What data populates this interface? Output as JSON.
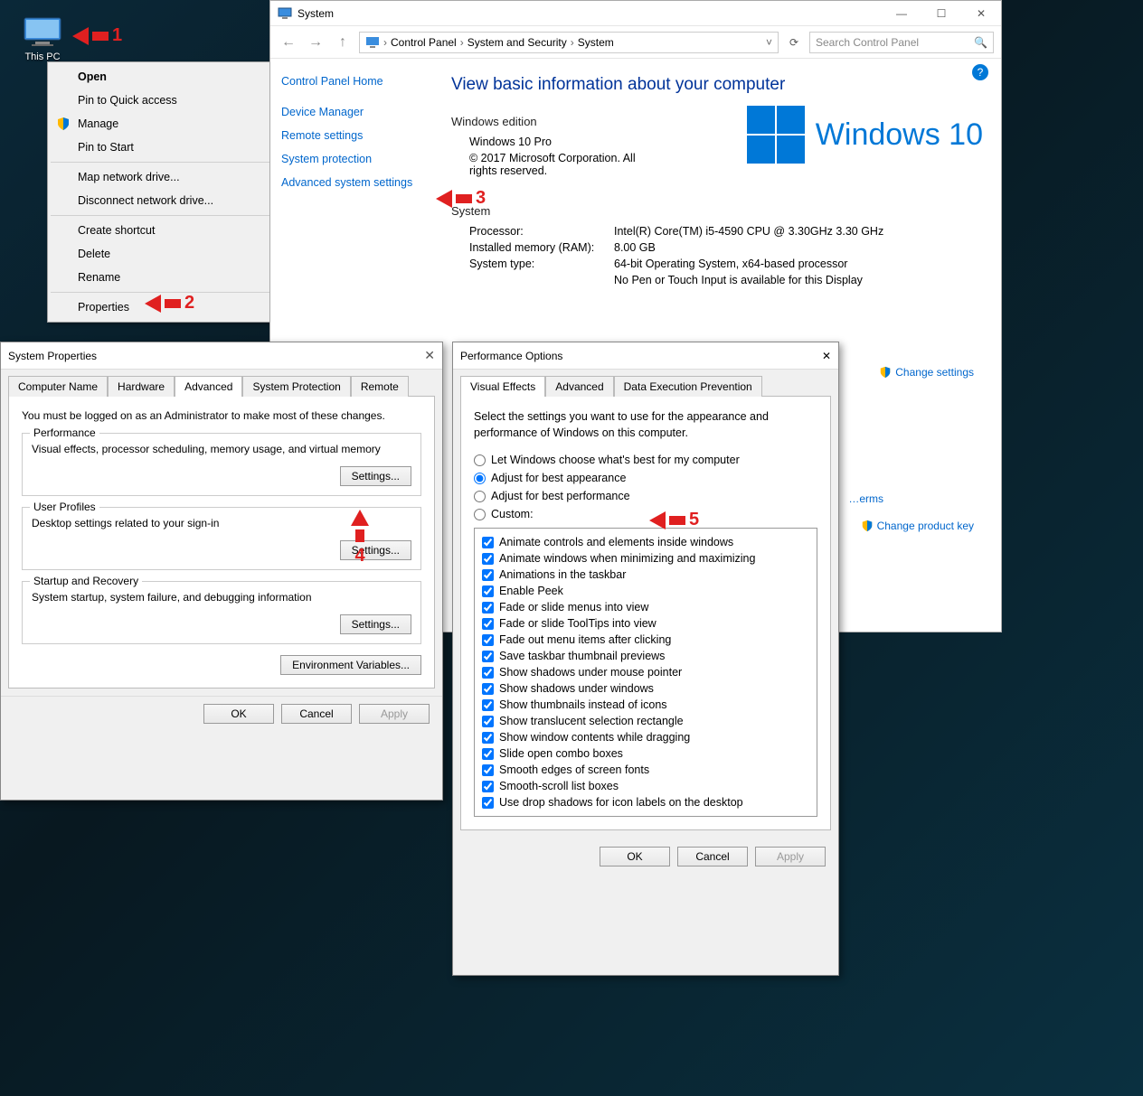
{
  "desktop": {
    "icon_label": "This PC"
  },
  "context_menu": {
    "items": [
      {
        "label": "Open",
        "bold": true
      },
      {
        "label": "Pin to Quick access"
      },
      {
        "label": "Manage",
        "shield": true
      },
      {
        "label": "Pin to Start"
      },
      {
        "sep": true
      },
      {
        "label": "Map network drive..."
      },
      {
        "label": "Disconnect network drive..."
      },
      {
        "sep": true
      },
      {
        "label": "Create shortcut"
      },
      {
        "label": "Delete"
      },
      {
        "label": "Rename"
      },
      {
        "sep": true
      },
      {
        "label": "Properties"
      }
    ]
  },
  "syswin": {
    "title": "System",
    "breadcrumb": [
      "Control Panel",
      "System and Security",
      "System"
    ],
    "search_placeholder": "Search Control Panel",
    "sidebar": {
      "home": "Control Panel Home",
      "links": [
        "Device Manager",
        "Remote settings",
        "System protection",
        "Advanced system settings"
      ]
    },
    "heading": "View basic information about your computer",
    "edition_hdr": "Windows edition",
    "edition": "Windows 10 Pro",
    "copyright": "© 2017 Microsoft Corporation. All rights reserved.",
    "logo_text": "Windows 10",
    "system_hdr": "System",
    "rows": [
      {
        "k": "Processor:",
        "v": "Intel(R) Core(TM) i5-4590 CPU @ 3.30GHz   3.30 GHz"
      },
      {
        "k": "Installed memory (RAM):",
        "v": "8.00 GB"
      },
      {
        "k": "System type:",
        "v": "64-bit Operating System, x64-based processor"
      }
    ],
    "pen_touch_v": "No Pen or Touch Input is available for this Display",
    "change_settings": "Change settings",
    "change_product_key": "Change product key",
    "see_also_terms": "Read the Microsoft Software License Terms"
  },
  "sysprops": {
    "title": "System Properties",
    "tabs": [
      "Computer Name",
      "Hardware",
      "Advanced",
      "System Protection",
      "Remote"
    ],
    "active_tab": 2,
    "admin_note": "You must be logged on as an Administrator to make most of these changes.",
    "groups": [
      {
        "title": "Performance",
        "desc": "Visual effects, processor scheduling, memory usage, and virtual memory",
        "btn": "Settings..."
      },
      {
        "title": "User Profiles",
        "desc": "Desktop settings related to your sign-in",
        "btn": "Settings..."
      },
      {
        "title": "Startup and Recovery",
        "desc": "System startup, system failure, and debugging information",
        "btn": "Settings..."
      }
    ],
    "env_btn": "Environment Variables...",
    "ok": "OK",
    "cancel": "Cancel",
    "apply": "Apply"
  },
  "perfopts": {
    "title": "Performance Options",
    "tabs": [
      "Visual Effects",
      "Advanced",
      "Data Execution Prevention"
    ],
    "active_tab": 0,
    "intro": "Select the settings you want to use for the appearance and performance of Windows on this computer.",
    "radios": [
      {
        "label": "Let Windows choose what's best for my computer",
        "checked": false
      },
      {
        "label": "Adjust for best appearance",
        "checked": true
      },
      {
        "label": "Adjust for best performance",
        "checked": false
      },
      {
        "label": "Custom:",
        "checked": false
      }
    ],
    "checks": [
      "Animate controls and elements inside windows",
      "Animate windows when minimizing and maximizing",
      "Animations in the taskbar",
      "Enable Peek",
      "Fade or slide menus into view",
      "Fade or slide ToolTips into view",
      "Fade out menu items after clicking",
      "Save taskbar thumbnail previews",
      "Show shadows under mouse pointer",
      "Show shadows under windows",
      "Show thumbnails instead of icons",
      "Show translucent selection rectangle",
      "Show window contents while dragging",
      "Slide open combo boxes",
      "Smooth edges of screen fonts",
      "Smooth-scroll list boxes",
      "Use drop shadows for icon labels on the desktop"
    ],
    "ok": "OK",
    "cancel": "Cancel",
    "apply": "Apply"
  },
  "annotations": {
    "n1": "1",
    "n2": "2",
    "n3": "3",
    "n4": "4",
    "n5": "5"
  }
}
